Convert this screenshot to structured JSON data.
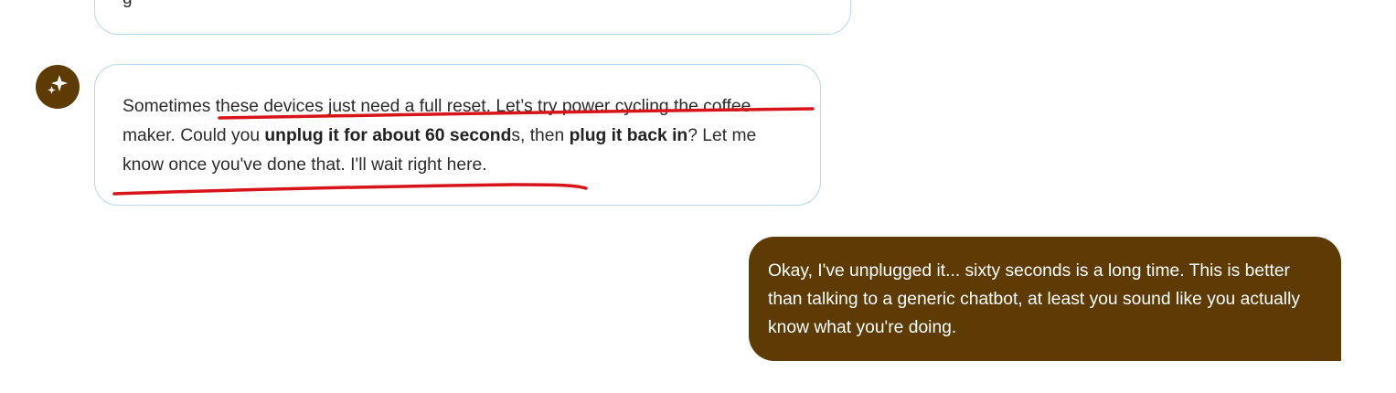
{
  "conversation": {
    "previous_message": {
      "visible_fragment": "g"
    },
    "assistant_message": {
      "avatar_icon": "sparkle-icon",
      "parts": [
        "Sometimes these devices just need a full reset. Let’s try power cycling the coffee maker. Could you ",
        "unplug it for about 60 second",
        "s, then ",
        "plug it back in",
        "? Let me know once you've done that. I'll wait right here."
      ]
    },
    "user_message": {
      "text": "Okay, I've unplugged it... sixty seconds is a long time. This is better than talking to a generic chatbot, at least you sound like you actually know what you're doing."
    }
  },
  "colors": {
    "brand_brown": "#5e3a05",
    "bubble_border": "#b9d7ea",
    "annotation_red": "#d7141a",
    "user_text": "#ffffff",
    "assistant_text": "#2b2b2b"
  },
  "annotations": {
    "type": "hand-drawn underline strokes",
    "count": 2
  }
}
